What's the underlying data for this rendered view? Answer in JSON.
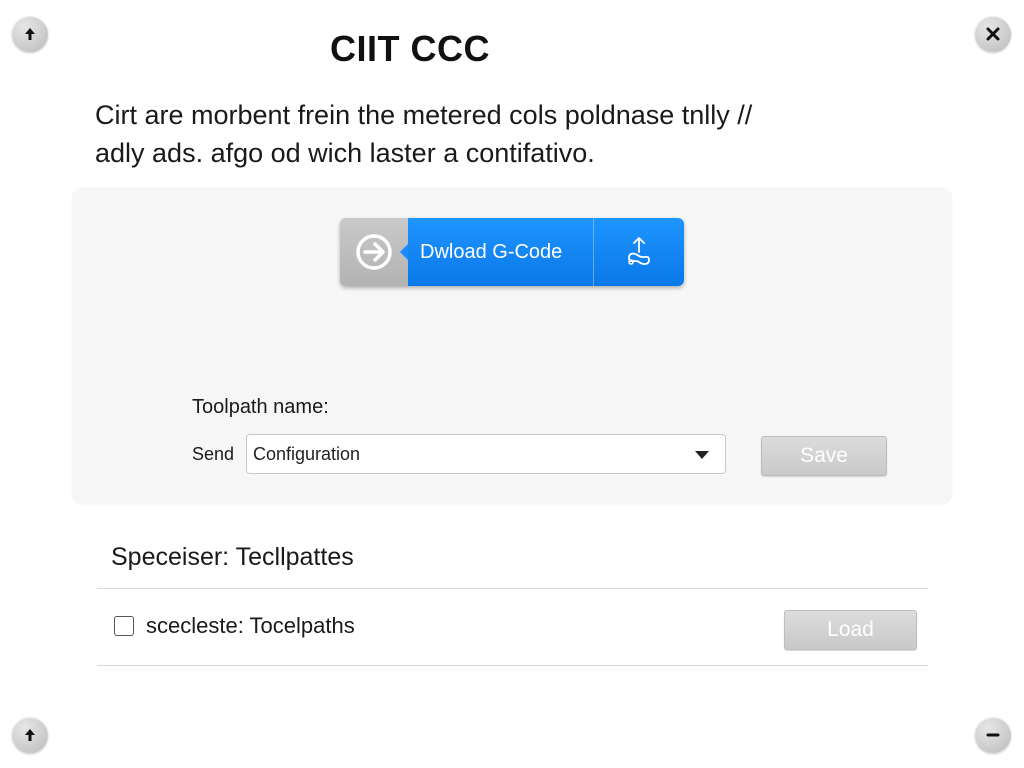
{
  "header": {
    "title": "CIIT CCC"
  },
  "description": {
    "line1": "Cirt are morbent frein the metered cols poldnase tnlly //",
    "line2": "adly ads. afgo od wich laster a contifativo."
  },
  "corner_buttons": {
    "top_left_icon": "arrow-up-icon",
    "top_right_icon": "close-icon",
    "bottom_left_icon": "arrow-up-icon",
    "bottom_right_icon": "minus-icon"
  },
  "download": {
    "label": "Dwload G-Code",
    "left_icon": "arrow-right-circle-icon",
    "right_icon": "share-icon",
    "color": "#1a8cff"
  },
  "form": {
    "toolpath_label": "Toolpath name:",
    "send_label": "Send",
    "select_value": "Configuration",
    "save_label": "Save"
  },
  "specifier": {
    "title": "Speceiser: Tecllpattes",
    "checkbox_label": "scecleste: Tocelpaths",
    "checkbox_checked": false,
    "load_label": "Load"
  }
}
